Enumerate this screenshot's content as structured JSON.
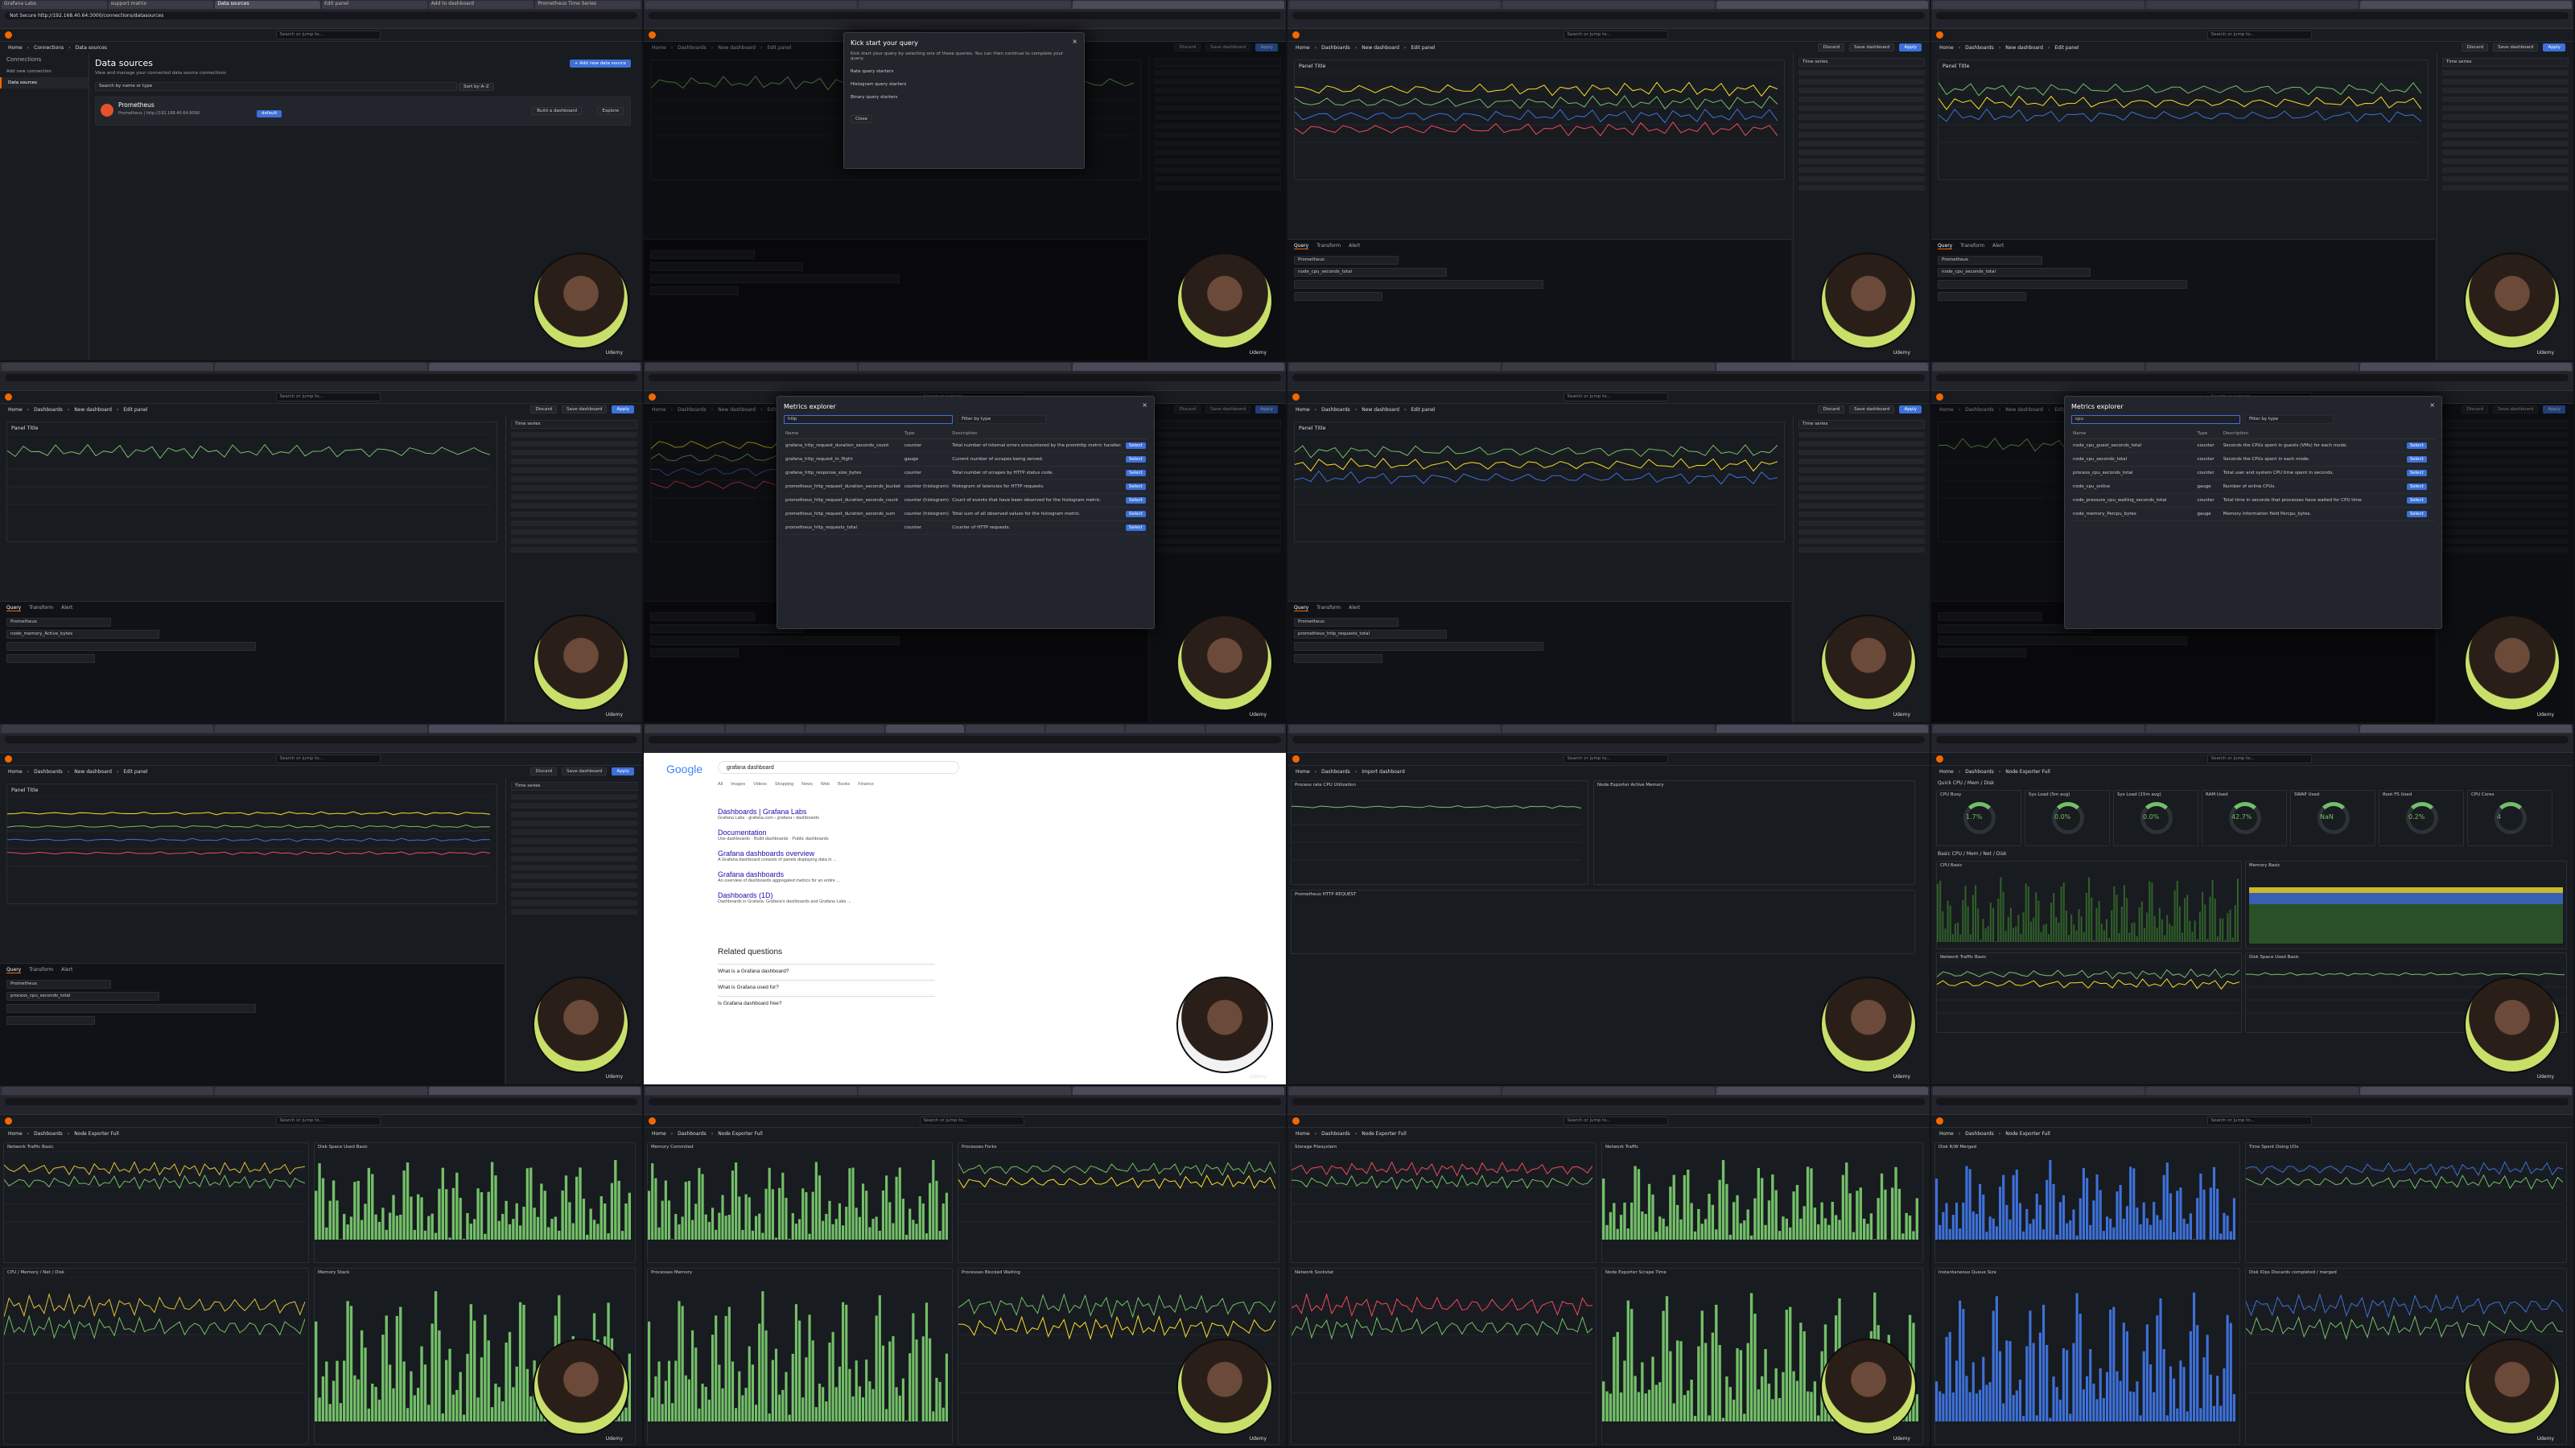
{
  "tiles": [
    {
      "id": 1,
      "kind": "datasources",
      "tabs": [
        "Grafana Labs",
        "support matrix",
        "Data sources",
        "Edit panel",
        "Add to dashboard",
        "Prometheus Time Series"
      ],
      "url": "Not Secure  http://192.168.40.64:3000/connections/datasources",
      "breadcrumb": [
        "Home",
        "Connections",
        "Data sources"
      ],
      "heading": "Data sources",
      "subheading": "View and manage your connected data source connections",
      "add_button": "+ Add new data source",
      "search_placeholder": "Search by name or type",
      "sort_label": "Sort by A–Z",
      "sidebar": [
        "Connections",
        "Add new connection",
        "Data sources"
      ],
      "ds_name": "Prometheus",
      "ds_type": "Prometheus | http://192.168.40.64:9090",
      "ds_default": "default",
      "ds_actions": [
        "Build a dashboard",
        "Explore"
      ]
    },
    {
      "id": 2,
      "kind": "modal-start",
      "breadcrumb": [
        "Home",
        "Dashboards",
        "New dashboard",
        "Edit panel"
      ],
      "modal_title": "Kick start your query",
      "modal_text": "Kick start your query by selecting one of these queries. You can then continue to complete your query.",
      "options": [
        "Rate query starters",
        "Histogram query starters",
        "Binary query starters"
      ],
      "close_label": "Close"
    },
    {
      "id": 3,
      "kind": "panel-edit",
      "breadcrumb": [
        "Home",
        "Dashboards",
        "New dashboard",
        "Edit panel"
      ],
      "panel_title": "Panel Title",
      "viz": "Time series",
      "metric": "node_cpu_seconds_total",
      "query_tabs": [
        "Query",
        "Transform",
        "Alert"
      ],
      "datasource": "Prometheus"
    },
    {
      "id": 4,
      "kind": "panel-edit",
      "breadcrumb": [
        "Home",
        "Dashboards",
        "New dashboard",
        "Edit panel"
      ],
      "panel_title": "Panel Title",
      "viz": "Time series",
      "metric": "node_cpu_seconds_total",
      "query_tabs": [
        "Query",
        "Transform",
        "Alert"
      ],
      "datasource": "Prometheus"
    },
    {
      "id": 5,
      "kind": "panel-edit",
      "breadcrumb": [
        "Home",
        "Dashboards",
        "New dashboard",
        "Edit panel"
      ],
      "panel_title": "Panel Title",
      "viz": "Time series",
      "metric": "node_memory_Active_bytes",
      "query_tabs": [
        "Query",
        "Transform",
        "Alert"
      ],
      "datasource": "Prometheus"
    },
    {
      "id": 6,
      "kind": "metrics-explorer",
      "breadcrumb": [
        "Home",
        "Dashboards",
        "New dashboard",
        "Edit panel"
      ],
      "modal_title": "Metrics explorer",
      "search_value": "http",
      "filter_label": "Filter by type",
      "columns": [
        "Name",
        "Type",
        "Description"
      ],
      "rows": [
        {
          "name": "grafana_http_request_duration_seconds_count",
          "type": "counter",
          "desc": "Total number of internal errors encountered by the promhttp metric handler."
        },
        {
          "name": "grafana_http_request_in_flight",
          "type": "gauge",
          "desc": "Current number of scrapes being served."
        },
        {
          "name": "grafana_http_response_size_bytes",
          "type": "counter",
          "desc": "Total number of scrapes by HTTP status code."
        },
        {
          "name": "prometheus_http_request_duration_seconds_bucket",
          "type": "counter (histogram)",
          "desc": "Histogram of latencies for HTTP requests."
        },
        {
          "name": "prometheus_http_request_duration_seconds_count",
          "type": "counter (histogram)",
          "desc": "Count of events that have been observed for the histogram metric."
        },
        {
          "name": "prometheus_http_request_duration_seconds_sum",
          "type": "counter (histogram)",
          "desc": "Total sum of all observed values for the histogram metric."
        },
        {
          "name": "prometheus_http_requests_total",
          "type": "counter",
          "desc": "Counter of HTTP requests."
        }
      ],
      "select_label": "Select"
    },
    {
      "id": 7,
      "kind": "panel-edit",
      "breadcrumb": [
        "Home",
        "Dashboards",
        "New dashboard",
        "Edit panel"
      ],
      "panel_title": "Panel Title",
      "viz": "Time series",
      "metric": "prometheus_http_requests_total",
      "query_tabs": [
        "Query",
        "Transform",
        "Alert"
      ],
      "datasource": "Prometheus"
    },
    {
      "id": 8,
      "kind": "metrics-explorer",
      "breadcrumb": [
        "Home",
        "Dashboards",
        "New dashboard",
        "Edit panel"
      ],
      "modal_title": "Metrics explorer",
      "search_value": "cpu",
      "filter_label": "Filter by type",
      "columns": [
        "Name",
        "Type",
        "Description"
      ],
      "rows": [
        {
          "name": "node_cpu_guest_seconds_total",
          "type": "counter",
          "desc": "Seconds the CPUs spent in guests (VMs) for each mode."
        },
        {
          "name": "node_cpu_seconds_total",
          "type": "counter",
          "desc": "Seconds the CPUs spent in each mode."
        },
        {
          "name": "process_cpu_seconds_total",
          "type": "counter",
          "desc": "Total user and system CPU time spent in seconds."
        },
        {
          "name": "node_cpu_online",
          "type": "gauge",
          "desc": "Number of online CPUs."
        },
        {
          "name": "node_pressure_cpu_waiting_seconds_total",
          "type": "counter",
          "desc": "Total time in seconds that processes have waited for CPU time."
        },
        {
          "name": "node_memory_Percpu_bytes",
          "type": "gauge",
          "desc": "Memory information field Percpu_bytes."
        }
      ],
      "select_label": "Select"
    },
    {
      "id": 9,
      "kind": "panel-edit",
      "breadcrumb": [
        "Home",
        "Dashboards",
        "New dashboard",
        "Edit panel"
      ],
      "panel_title": "Panel Title",
      "viz": "Time series",
      "metric": "process_cpu_seconds_total",
      "query_tabs": [
        "Query",
        "Transform",
        "Alert"
      ],
      "datasource": "Prometheus"
    },
    {
      "id": 10,
      "kind": "google",
      "search": "grafana dashboard",
      "nav": [
        "All",
        "Images",
        "Videos",
        "Shopping",
        "News",
        "Web",
        "Books",
        "Finance"
      ],
      "results": [
        {
          "title": "Dashboards | Grafana Labs",
          "snippet": "Grafana Labs · grafana.com › grafana › dashboards"
        },
        {
          "title": "Documentation",
          "snippet": "Use dashboards · Build dashboards · Public dashboards"
        },
        {
          "title": "Grafana dashboards overview",
          "snippet": "A Grafana dashboard consists of panels displaying data in ..."
        },
        {
          "title": "Grafana dashboards",
          "snippet": "An overview of dashboards aggregated metrics for an entire ..."
        },
        {
          "title": "Dashboards (1D)",
          "snippet": "Dashboards in Grafana. Grafana's dashboards and Grafana Labs ..."
        }
      ],
      "related_title": "Related questions",
      "questions": [
        "What is a Grafana dashboard?",
        "What is Grafana used for?",
        "Is Grafana dashboard free?"
      ]
    },
    {
      "id": 11,
      "kind": "import",
      "breadcrumb": [
        "Home",
        "Dashboards",
        "Import dashboard"
      ],
      "left_title": "Process rate CPU Utilization",
      "right_title": "Node Exporter Active Memory",
      "bottom_title": "Prometheus HTTP REQUEST"
    },
    {
      "id": 12,
      "kind": "node-exporter",
      "breadcrumb": [
        "Home",
        "Dashboards",
        "Node Exporter Full"
      ],
      "section1": "Quick CPU / Mem / Disk",
      "gauges": [
        {
          "label": "CPU Busy",
          "value": "1.7%"
        },
        {
          "label": "Sys Load (5m avg)",
          "value": "0.0%"
        },
        {
          "label": "Sys Load (15m avg)",
          "value": "0.0%"
        },
        {
          "label": "RAM Used",
          "value": "42.7%"
        },
        {
          "label": "SWAP Used",
          "value": "NaN"
        },
        {
          "label": "Root FS Used",
          "value": "0.2%"
        },
        {
          "label": "CPU Cores",
          "value": "4"
        }
      ],
      "section2": "Basic CPU / Mem / Net / Disk",
      "p_cpu": "CPU Basic",
      "p_mem": "Memory Basic",
      "p_net": "Network Traffic Basic",
      "p_disk": "Disk Space Used Basic"
    },
    {
      "id": 13,
      "kind": "dash-generic",
      "breadcrumb": [
        "Home",
        "Dashboards",
        "Node Exporter Full"
      ],
      "titles": [
        "Network Traffic Basic",
        "Disk Space Used Basic",
        "CPU / Memory / Net / Disk",
        "Memory Stack"
      ]
    },
    {
      "id": 14,
      "kind": "dash-generic",
      "breadcrumb": [
        "Home",
        "Dashboards",
        "Node Exporter Full"
      ],
      "titles": [
        "Memory Commited",
        "Processes Forks",
        "Processes Memory",
        "Processes Blocked Waiting"
      ]
    },
    {
      "id": 15,
      "kind": "dash-generic",
      "breadcrumb": [
        "Home",
        "Dashboards",
        "Node Exporter Full"
      ],
      "titles": [
        "Storage Filesystem",
        "Network Traffic",
        "Network Sockstat",
        "Node Exporter Scrape Time"
      ]
    },
    {
      "id": 16,
      "kind": "dash-generic",
      "breadcrumb": [
        "Home",
        "Dashboards",
        "Node Exporter Full"
      ],
      "titles": [
        "Disk R/W Merged",
        "Time Spent Doing I/Os",
        "Instantaneous Queue Size",
        "Disk IOps Discards completed / merged"
      ]
    }
  ],
  "common": {
    "search_placeholder": "Search or jump to...",
    "watermark": "Udemy",
    "time_range": "Last 6 hours",
    "refresh": "Refresh",
    "apply": "Apply",
    "discard": "Discard",
    "save": "Save dashboard"
  },
  "colors": {
    "grafana_orange": "#f46800",
    "green": "#73bf69",
    "yellow": "#fade2a",
    "blue": "#3d71d9",
    "red": "#f2495c"
  }
}
